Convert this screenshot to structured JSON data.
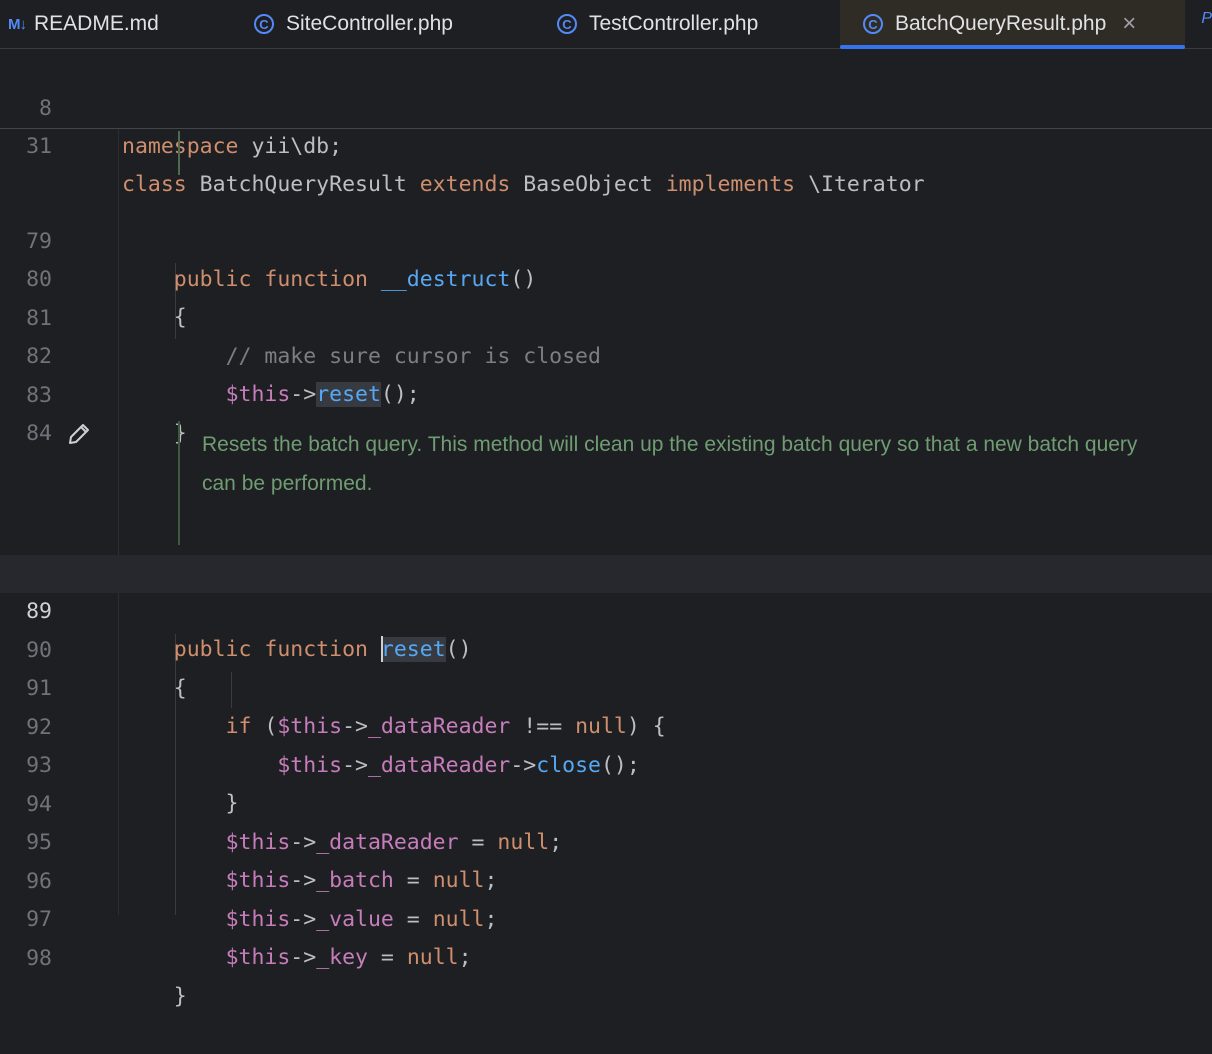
{
  "tabs": [
    {
      "label": "README.md",
      "icon": "markdown-icon",
      "icon_text": "M↓"
    },
    {
      "label": "SiteController.php",
      "icon": "php-class-icon",
      "icon_text": "C"
    },
    {
      "label": "TestController.php",
      "icon": "php-class-icon",
      "icon_text": "C"
    },
    {
      "label": "BatchQueryResult.php",
      "icon": "php-class-icon",
      "icon_text": "C",
      "active": true,
      "close": "×"
    }
  ],
  "tab_overflow_text": "P",
  "sticky_lines": [
    {
      "number": "8",
      "text": "namespace yii\\db;"
    },
    {
      "number": "31",
      "text": "class BatchQueryResult extends BaseObject implements \\Iterator"
    }
  ],
  "line_numbers": {
    "l79": "79",
    "l80": "80",
    "l81": "81",
    "l82": "82",
    "l83": "83",
    "l84": "84",
    "l89": "89",
    "l90": "90",
    "l91": "91",
    "l92": "92",
    "l93": "93",
    "l94": "94",
    "l95": "95",
    "l96": "96",
    "l97": "97",
    "l98": "98"
  },
  "doc_comment": [
    "Resets the batch query. This method will clean up the existing batch query so that a new batch query",
    "can be performed."
  ],
  "colors": {
    "background": "#1e1f22",
    "keyword": "#cf8e6d",
    "function": "#56a8f5",
    "variable": "#c77dbb",
    "comment": "#7a7e85",
    "doc_comment": "#6f9c73",
    "accent": "#3574f0"
  }
}
